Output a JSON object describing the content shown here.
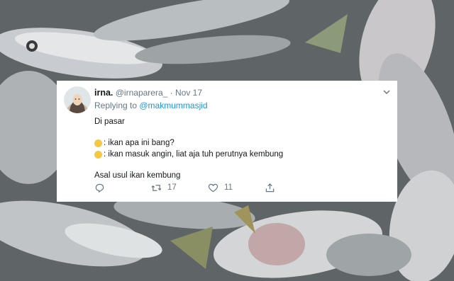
{
  "tweet": {
    "display_name": "irna.",
    "handle": "@irnaparera_",
    "separator": " · ",
    "date": "Nov 17",
    "replying_prefix": "Replying to ",
    "replying_handle": "@makmummasjid",
    "lines": {
      "l1": "Di pasar",
      "l2": ": ikan apa ini bang?",
      "l3": ": ikan masuk angin, liat aja tuh perutnya kembung",
      "l4": "Asal usul ikan kembung"
    },
    "actions": {
      "reply_icon": "reply-icon",
      "retweet_icon": "retweet-icon",
      "retweet_count": "17",
      "like_icon": "heart-icon",
      "like_count": "11",
      "share_icon": "share-icon"
    }
  },
  "colors": {
    "name": "#14171a",
    "secondary": "#657786",
    "link": "#1b95e0",
    "card_bg": "#ffffff"
  }
}
